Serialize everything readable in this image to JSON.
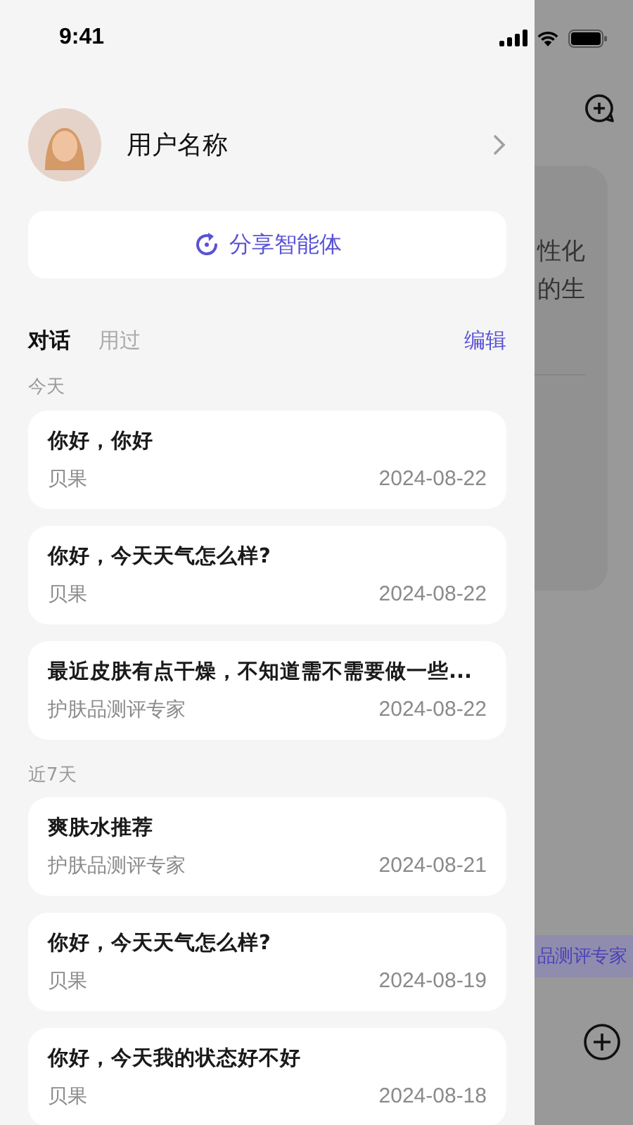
{
  "status_bar": {
    "time": "9:41"
  },
  "drawer": {
    "user": {
      "name": "用户名称"
    },
    "share_button": {
      "label": "分享智能体"
    },
    "tabs": [
      {
        "label": "对话",
        "selected": true
      },
      {
        "label": "用过",
        "selected": false
      }
    ],
    "edit_action": "编辑",
    "sections": [
      {
        "label": "今天",
        "conversations": [
          {
            "title": "你好，你好",
            "agent": "贝果",
            "date": "2024-08-22"
          },
          {
            "title": "你好，今天天气怎么样?",
            "agent": "贝果",
            "date": "2024-08-22"
          },
          {
            "title": "最近皮肤有点干燥，不知道需不需要做一些...",
            "agent": "护肤品测评专家",
            "date": "2024-08-22"
          }
        ]
      },
      {
        "label": "近7天",
        "conversations": [
          {
            "title": "爽肤水推荐",
            "agent": "护肤品测评专家",
            "date": "2024-08-21"
          },
          {
            "title": "你好，今天天气怎么样?",
            "agent": "贝果",
            "date": "2024-08-19"
          },
          {
            "title": "你好，今天我的状态好不好",
            "agent": "贝果",
            "date": "2024-08-18"
          }
        ]
      }
    ]
  },
  "background_page": {
    "message_lines": [
      "性化",
      "的生"
    ],
    "agent_tag": "品测评专家"
  }
}
